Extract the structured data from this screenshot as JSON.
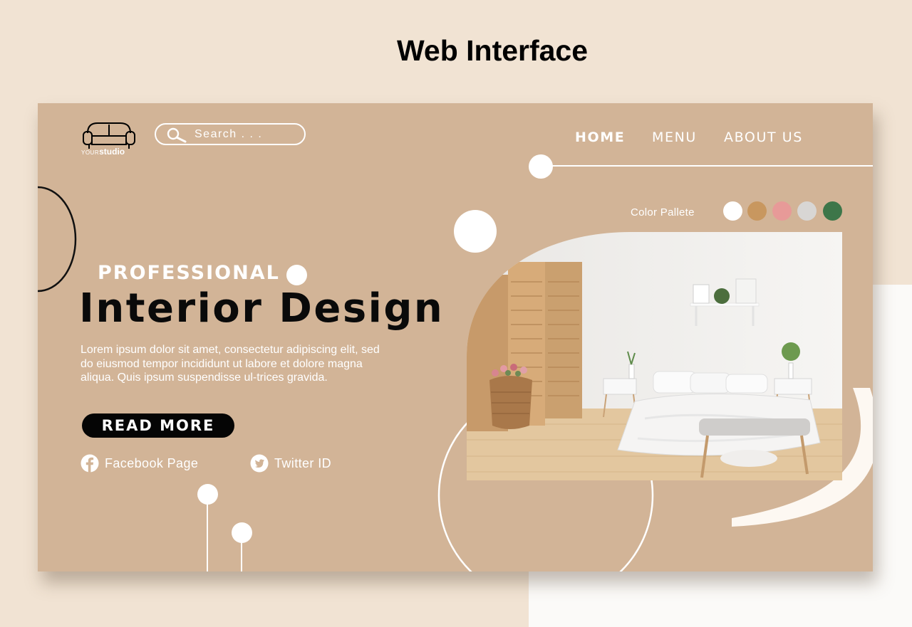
{
  "page_heading": "Web Interface",
  "logo": {
    "your": "YOUR",
    "studio": "studio"
  },
  "search": {
    "placeholder": "Search . . ."
  },
  "nav": {
    "home": "HOME",
    "menu": "MENU",
    "about": "ABOUT US"
  },
  "palette": {
    "label": "Color Pallete",
    "colors": [
      "#ffffff",
      "#c8975f",
      "#e79a98",
      "#d8d6d4",
      "#3d7649"
    ]
  },
  "hero": {
    "kicker": "PROFESSIONAL",
    "headline": "Interior Design",
    "body": "Lorem ipsum dolor sit amet, consectetur adipiscing elit, sed do eiusmod tempor incididunt ut labore et dolore magna aliqua. Quis ipsum suspendisse ul-trices gravida.",
    "cta": "READ MORE"
  },
  "social": {
    "facebook": "Facebook Page",
    "twitter": "Twitter ID"
  },
  "colors": {
    "card": "#d2b497",
    "page": "#f1e3d3",
    "accent_dark": "#050505"
  }
}
